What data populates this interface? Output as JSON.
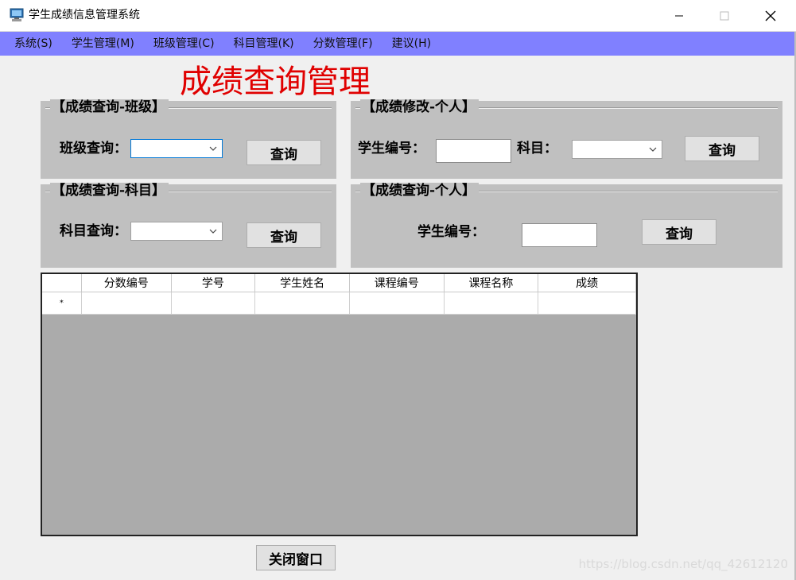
{
  "window": {
    "title": "学生成绩信息管理系统",
    "icon": "computer-icon",
    "controls": [
      "minimize-icon",
      "maximize-icon",
      "close-icon"
    ]
  },
  "menu": {
    "items": [
      {
        "label": "系统(S)"
      },
      {
        "label": "学生管理(M)"
      },
      {
        "label": "班级管理(C)"
      },
      {
        "label": "科目管理(K)"
      },
      {
        "label": "分数管理(F)"
      },
      {
        "label": "建议(H)"
      }
    ]
  },
  "page_title": "成绩查询管理",
  "groups": {
    "class_query": {
      "legend": "【成绩查询-班级】",
      "label": "班级查询：",
      "select_value": "",
      "button": "查询"
    },
    "subject_query": {
      "legend": "【成绩查询-科目】",
      "label": "科目查询：",
      "select_value": "",
      "button": "查询"
    },
    "personal_edit": {
      "legend": "【成绩修改-个人】",
      "student_label": "学生编号：",
      "student_value": "",
      "subject_label": "科目：",
      "subject_value": "",
      "button": "查询"
    },
    "personal_query": {
      "legend": "【成绩查询-个人】",
      "student_label": "学生编号：",
      "student_value": "",
      "button": "查询"
    }
  },
  "grid": {
    "columns": [
      "分数编号",
      "学号",
      "学生姓名",
      "课程编号",
      "课程名称",
      "成绩"
    ],
    "new_row_marker": "*"
  },
  "close_button": "关闭窗口",
  "watermark": "https://blog.csdn.net/qq_42612120",
  "colors": {
    "menubar": "#8080ff",
    "title_red": "#e00000",
    "panel_gray": "#c0c0c0",
    "grid_bg": "#ababab"
  }
}
